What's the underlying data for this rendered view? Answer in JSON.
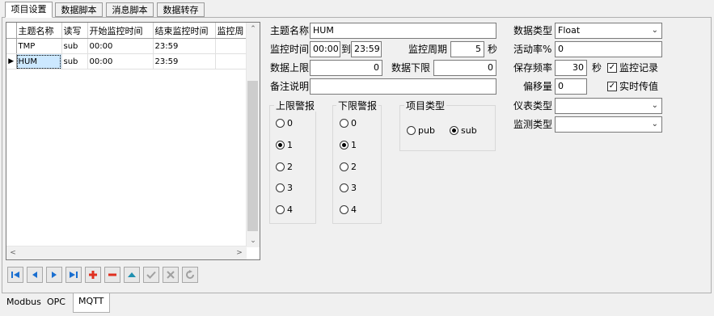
{
  "top_tabs": [
    "项目设置",
    "数据脚本",
    "消息脚本",
    "数据转存"
  ],
  "grid": {
    "columns": [
      "主题名称",
      "读写",
      "开始监控时间",
      "结束监控时间",
      "监控周"
    ],
    "rows": [
      [
        "TMP",
        "sub",
        "00:00",
        "23:59",
        ""
      ],
      [
        "HUM",
        "sub",
        "00:00",
        "23:59",
        ""
      ]
    ],
    "current_row_indicator": "▶"
  },
  "nav_buttons": [
    "first",
    "prior",
    "next",
    "last",
    "insert",
    "delete",
    "edit",
    "post",
    "cancel",
    "refresh"
  ],
  "form": {
    "topic_label": "主题名称",
    "topic_value": "HUM",
    "monitor_time_label": "监控时间",
    "start_time": "00:00",
    "to_label": "到",
    "end_time": "23:59",
    "period_label": "监控周期",
    "period_value": "5",
    "period_unit": "秒",
    "upper_label": "数据上限",
    "upper_value": "0",
    "lower_label": "数据下限",
    "lower_value": "0",
    "note_label": "备注说明",
    "note_value": "",
    "data_type_label": "数据类型",
    "data_type_value": "Float",
    "active_rate_label": "活动率%",
    "active_rate_value": "0",
    "save_freq_label": "保存频率",
    "save_freq_value": "30",
    "save_freq_unit": "秒",
    "monitor_record_label": "监控记录",
    "monitor_record_checked": "✓",
    "offset_label": "偏移量",
    "offset_value": "0",
    "realtime_label": "实时传值",
    "realtime_checked": "✓",
    "meter_type_label": "仪表类型",
    "meter_type_value": "",
    "detect_type_label": "监测类型",
    "detect_type_value": ""
  },
  "upper_alarm": {
    "title": "上限警报",
    "options": [
      "0",
      "1",
      "2",
      "3",
      "4"
    ],
    "selected": "1"
  },
  "lower_alarm": {
    "title": "下限警报",
    "options": [
      "0",
      "1",
      "2",
      "3",
      "4"
    ],
    "selected": "1"
  },
  "item_type": {
    "title": "项目类型",
    "options": [
      "pub",
      "sub"
    ],
    "selected": "sub"
  },
  "bottom_tabs": [
    "Modbus",
    "OPC",
    "MQTT"
  ],
  "colors": {
    "nav_blue": "#1a6fd0",
    "nav_red": "#e03020",
    "nav_teal": "#2090b0",
    "nav_disabled": "#a0a0a0"
  }
}
